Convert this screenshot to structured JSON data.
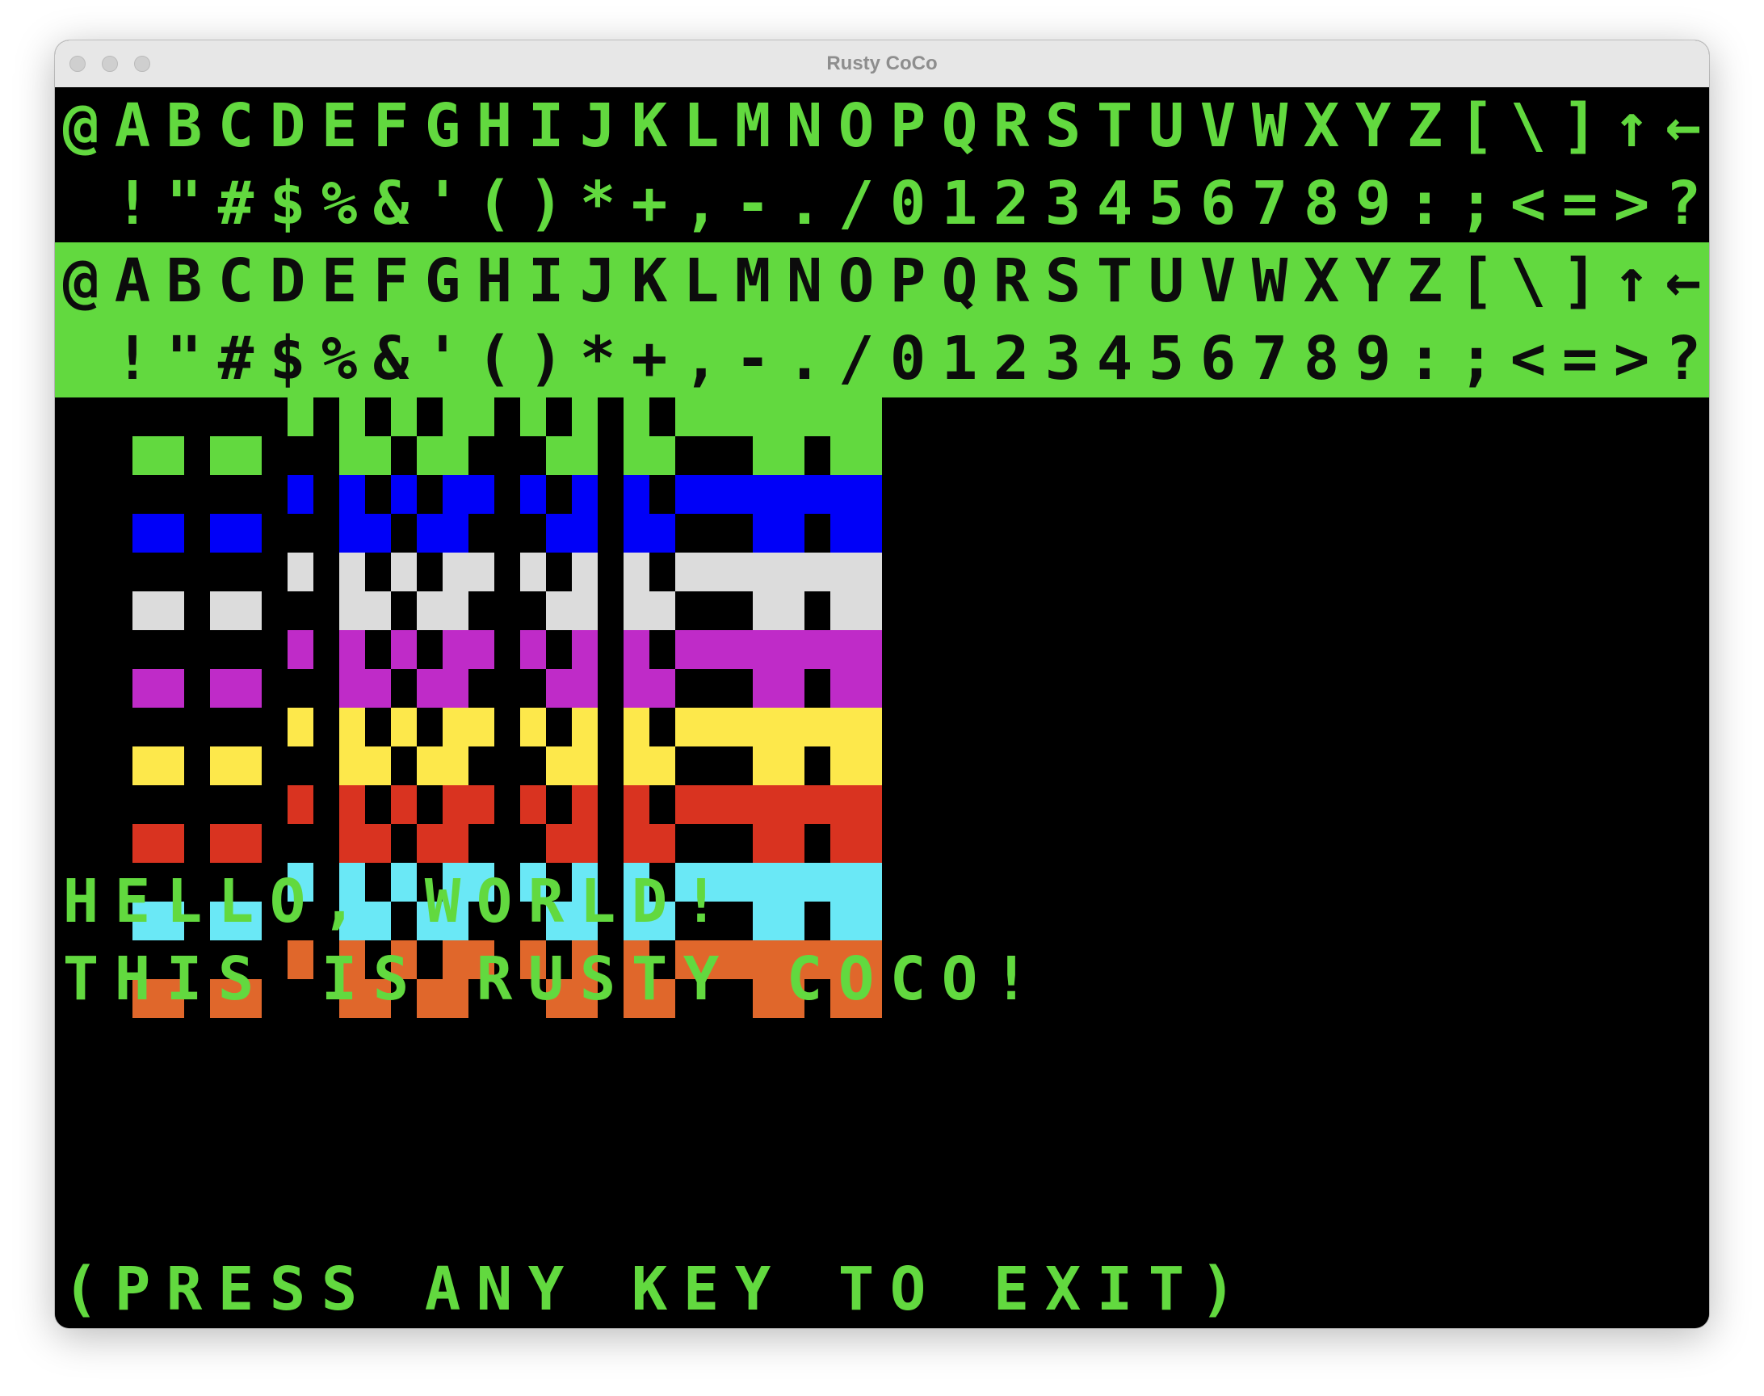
{
  "window": {
    "title": "Rusty CoCo"
  },
  "screen": {
    "colors": {
      "background": "#000000",
      "text": "#62d93f",
      "semigraphics": [
        "#62d93f",
        "#0000f8",
        "#dcdcdc",
        "#bf2bc8",
        "#fde84b",
        "#d93320",
        "#6ae8f6",
        "#e0672b"
      ]
    },
    "charset_rows": [
      {
        "mode": "normal",
        "text": "@ABCDEFGHIJKLMNOPQRSTUVWXYZ[\\]↑←"
      },
      {
        "mode": "normal",
        "text": " !\"#$%&'()*+,-./0123456789:;<=>?"
      },
      {
        "mode": "inverse",
        "text": "@ABCDEFGHIJKLMNOPQRSTUVWXYZ[\\]↑←"
      },
      {
        "mode": "inverse",
        "text": " !\"#$%&'()*+,-./0123456789:;<=>?"
      }
    ],
    "semigraphics": {
      "codes_per_row": 16,
      "rows": 8
    },
    "lines": {
      "line1": "HELLO, WORLD!",
      "line2": "THIS IS RUSTY COCO!",
      "line3": "(PRESS ANY KEY TO EXIT)"
    }
  }
}
